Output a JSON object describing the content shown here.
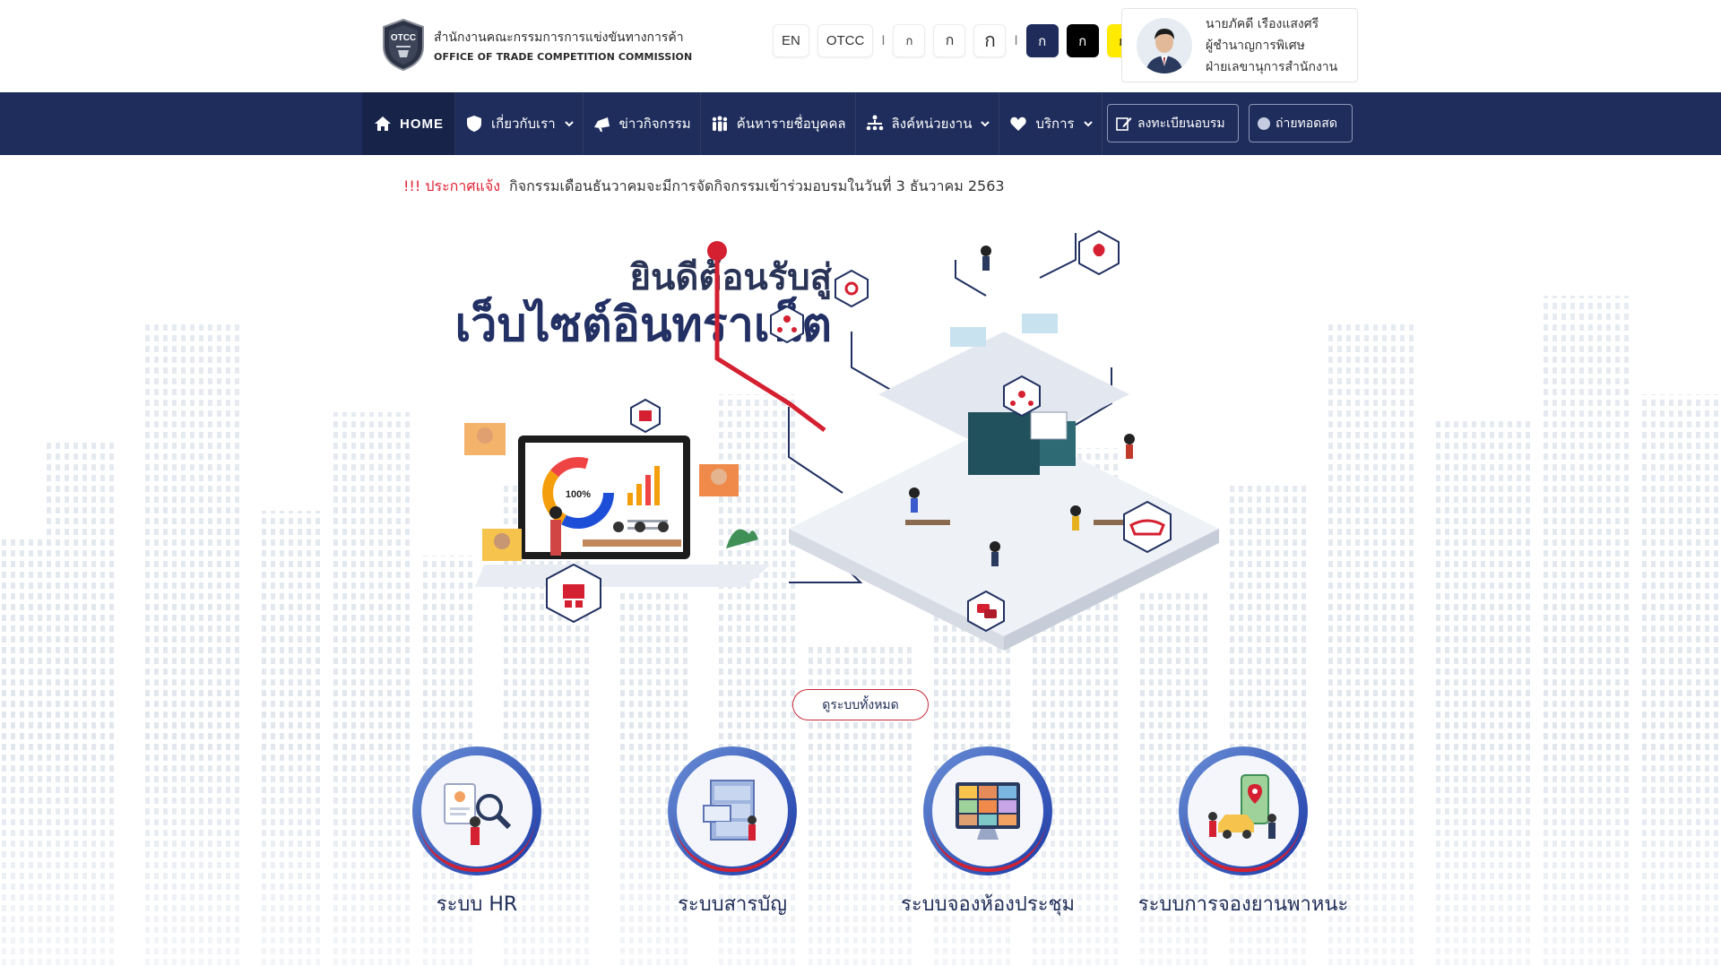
{
  "header": {
    "logo_th": "สำนักงานคณะกรรมการการแข่งขันทางการค้า",
    "logo_en": "OFFICE OF TRADE COMPETITION COMMISSION",
    "logo_badge_text": "OTCC"
  },
  "tools": {
    "lang": "EN",
    "site": "OTCC",
    "font_small": "ก",
    "font_medium": "ก",
    "font_large": "ก",
    "contrast_navy": "ก",
    "contrast_black": "ก",
    "contrast_yellow": "ก",
    "separator": "I"
  },
  "user": {
    "name": "นายภัคดี เรืองแสงศรี",
    "position": "ผู้ชำนาญการพิเศษ",
    "department": "ฝ่ายเลขานุการสำนักงาน"
  },
  "nav": {
    "home": "HOME",
    "about": "เกี่ยวกับเรา",
    "news": "ข่าวกิจกรรม",
    "search_people": "ค้นหารายชื่อบุคคล",
    "links": "ลิงค์หน่วยงาน",
    "services": "บริการ",
    "register": "ลงทะเบียนอบรม",
    "live": "ถ่ายทอดสด"
  },
  "announcement": {
    "label": "!!! ประกาศแจ้ง",
    "text": "กิจกรรมเดือนธันวาคมจะมีการจัดกิจกรรมเข้าร่วมอบรมในวันที่ 3 ธันวาคม 2563"
  },
  "hero": {
    "welcome_line1": "ยินดีต้อนรับสู่",
    "welcome_line2": "เว็บไซต์อินทราเน็ต",
    "dashboard_percent": "100%"
  },
  "view_all": "ดูระบบทั้งหมด",
  "systems": [
    {
      "label": "ระบบ HR",
      "icon": "hr-recruitment-icon"
    },
    {
      "label": "ระบบสารบัญ",
      "icon": "filing-cabinet-icon"
    },
    {
      "label": "ระบบจองห้องประชุม",
      "icon": "video-meeting-icon"
    },
    {
      "label": "ระบบการจองยานพาหนะ",
      "icon": "vehicle-booking-icon"
    }
  ],
  "colors": {
    "navy": "#1f2d5c",
    "accent_red": "#d42030",
    "contrast_yellow": "#ffea00"
  }
}
